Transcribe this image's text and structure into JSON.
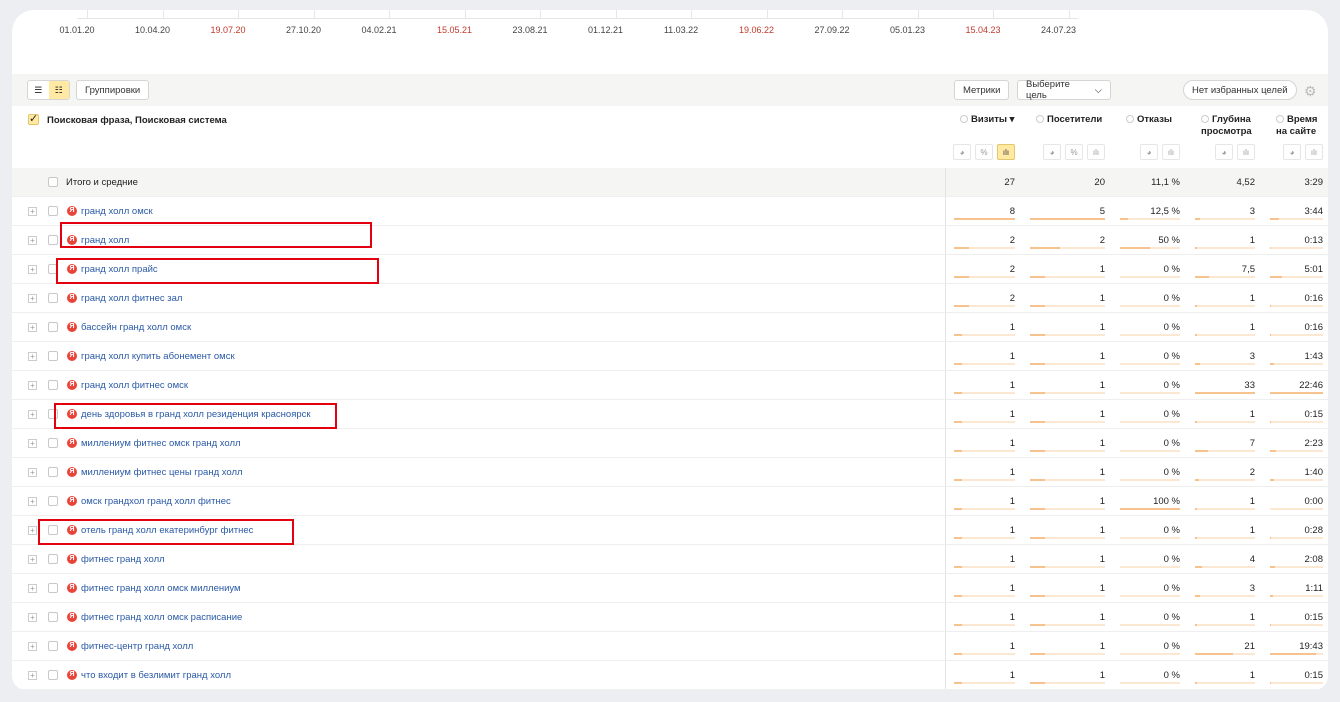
{
  "axis": {
    "labels": [
      {
        "t": "01.01.20",
        "red": false
      },
      {
        "t": "10.04.20",
        "red": false
      },
      {
        "t": "19.07.20",
        "red": true
      },
      {
        "t": "27.10.20",
        "red": false
      },
      {
        "t": "04.02.21",
        "red": false
      },
      {
        "t": "15.05.21",
        "red": true
      },
      {
        "t": "23.08.21",
        "red": false
      },
      {
        "t": "01.12.21",
        "red": false
      },
      {
        "t": "11.03.22",
        "red": false
      },
      {
        "t": "19.06.22",
        "red": true
      },
      {
        "t": "27.09.22",
        "red": false
      },
      {
        "t": "05.01.23",
        "red": false
      },
      {
        "t": "15.04.23",
        "red": true
      },
      {
        "t": "24.07.23",
        "red": false
      }
    ]
  },
  "toolbar": {
    "groupings": "Группировки",
    "metrics": "Метрики",
    "goal": "Выберите цель",
    "favorites": "Нет избранных целей"
  },
  "header": {
    "dimension": "Поисковая фраза, Поисковая система",
    "columns": [
      {
        "l1": "Визиты ▾",
        "l2": ""
      },
      {
        "l1": "Посетители",
        "l2": ""
      },
      {
        "l1": "Отказы",
        "l2": ""
      },
      {
        "l1": "Глубина",
        "l2": "просмотра"
      },
      {
        "l1": "Время",
        "l2": "на сайте"
      }
    ]
  },
  "total": {
    "label": "Итого и средние",
    "values": [
      "27",
      "20",
      "11,1 %",
      "4,52",
      "3:29"
    ]
  },
  "rows": [
    {
      "phrase": "гранд холл омск",
      "values": [
        "8",
        "5",
        "12,5 %",
        "3",
        "3:44"
      ],
      "highlight": false
    },
    {
      "phrase": "гранд холл",
      "values": [
        "2",
        "2",
        "50 %",
        "1",
        "0:13"
      ],
      "highlight": true
    },
    {
      "phrase": "гранд холл прайс",
      "values": [
        "2",
        "1",
        "0 %",
        "7,5",
        "5:01"
      ],
      "highlight": true
    },
    {
      "phrase": "гранд холл фитнес зал",
      "values": [
        "2",
        "1",
        "0 %",
        "1",
        "0:16"
      ],
      "highlight": false
    },
    {
      "phrase": "бассейн гранд холл омск",
      "values": [
        "1",
        "1",
        "0 %",
        "1",
        "0:16"
      ],
      "highlight": false
    },
    {
      "phrase": "гранд холл купить абонемент омск",
      "values": [
        "1",
        "1",
        "0 %",
        "3",
        "1:43"
      ],
      "highlight": false
    },
    {
      "phrase": "гранд холл фитнес омск",
      "values": [
        "1",
        "1",
        "0 %",
        "33",
        "22:46"
      ],
      "highlight": false
    },
    {
      "phrase": "день здоровья в гранд холл резиденция красноярск",
      "values": [
        "1",
        "1",
        "0 %",
        "1",
        "0:15"
      ],
      "highlight": true
    },
    {
      "phrase": "миллениум фитнес омск гранд холл",
      "values": [
        "1",
        "1",
        "0 %",
        "7",
        "2:23"
      ],
      "highlight": false
    },
    {
      "phrase": "миллениум фитнес цены гранд холл",
      "values": [
        "1",
        "1",
        "0 %",
        "2",
        "1:40"
      ],
      "highlight": false
    },
    {
      "phrase": "омск грандхол гранд холл фитнес",
      "values": [
        "1",
        "1",
        "100 %",
        "1",
        "0:00"
      ],
      "highlight": false
    },
    {
      "phrase": "отель гранд холл екатеринбург фитнес",
      "values": [
        "1",
        "1",
        "0 %",
        "1",
        "0:28"
      ],
      "highlight": true
    },
    {
      "phrase": "фитнес гранд холл",
      "values": [
        "1",
        "1",
        "0 %",
        "4",
        "2:08"
      ],
      "highlight": false
    },
    {
      "phrase": "фитнес гранд холл омск миллениум",
      "values": [
        "1",
        "1",
        "0 %",
        "3",
        "1:11"
      ],
      "highlight": false
    },
    {
      "phrase": "фитнес гранд холл омск расписание",
      "values": [
        "1",
        "1",
        "0 %",
        "1",
        "0:15"
      ],
      "highlight": false
    },
    {
      "phrase": "фитнес-центр гранд холл",
      "values": [
        "1",
        "1",
        "0 %",
        "21",
        "19:43"
      ],
      "highlight": false
    },
    {
      "phrase": "что входит в безлимит гранд холл",
      "values": [
        "1",
        "1",
        "0 %",
        "1",
        "0:15"
      ],
      "highlight": false
    }
  ],
  "colors": {
    "link": "#2a5aa6",
    "accent": "#ffe9a3",
    "bar": "#f6c28e",
    "highlight": "#e3000f",
    "yandex": "#e8443a"
  }
}
